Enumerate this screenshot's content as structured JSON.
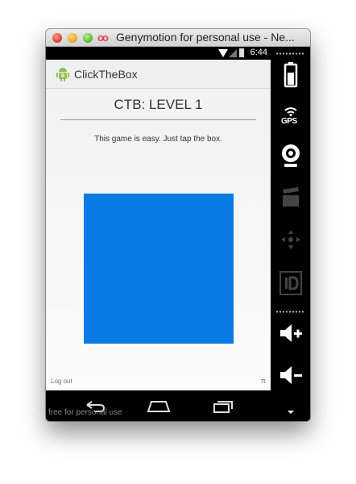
{
  "window": {
    "title": "Genymotion for personal use - Ne..."
  },
  "status": {
    "time": "6:44"
  },
  "actionbar": {
    "app_name": "ClickTheBox"
  },
  "game": {
    "level_title": "CTB: LEVEL 1",
    "instructions": "This game is easy. Just tap the box.",
    "box_color": "#0a7be4"
  },
  "footer": {
    "logout": "Log out",
    "pi": "π"
  },
  "watermark": "free for personal use",
  "sidepanel": {
    "gps_label": "GPS"
  },
  "icons": {
    "window_controls": [
      "close-icon",
      "minimize-icon",
      "zoom-icon"
    ],
    "genymotion": "genymotion-logo-icon",
    "status": [
      "wifi-icon",
      "signal-icon",
      "battery-icon"
    ],
    "app": "android-app-icon",
    "nav": [
      "back-icon",
      "home-icon",
      "recent-apps-icon"
    ],
    "side": [
      "battery-icon",
      "gps-icon",
      "camera-icon",
      "video-capture-icon",
      "dpad-icon",
      "id-icon",
      "volume-up-icon",
      "volume-down-icon",
      "scroll-down-icon"
    ]
  }
}
